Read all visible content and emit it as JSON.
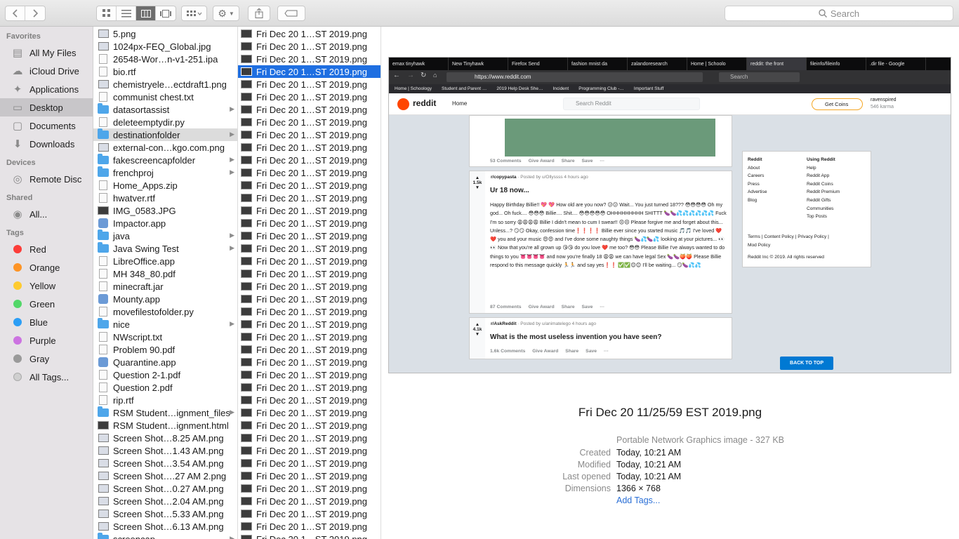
{
  "window": {
    "search_placeholder": "Search"
  },
  "toolbar": {
    "back_icon": "chevron-left-icon",
    "forward_icon": "chevron-right-icon",
    "view_modes": [
      "icon-view-icon",
      "list-view-icon",
      "column-view-icon",
      "gallery-view-icon"
    ],
    "active_view": 2
  },
  "sidebar": {
    "favorites_header": "Favorites",
    "favorites": [
      {
        "label": "All My Files",
        "icon": "all-files-icon"
      },
      {
        "label": "iCloud Drive",
        "icon": "cloud-icon"
      },
      {
        "label": "Applications",
        "icon": "applications-icon"
      },
      {
        "label": "Desktop",
        "icon": "desktop-icon",
        "selected": true
      },
      {
        "label": "Documents",
        "icon": "documents-icon"
      },
      {
        "label": "Downloads",
        "icon": "downloads-icon"
      }
    ],
    "devices_header": "Devices",
    "devices": [
      {
        "label": "Remote Disc",
        "icon": "disc-icon"
      }
    ],
    "shared_header": "Shared",
    "shared": [
      {
        "label": "All...",
        "icon": "network-icon"
      }
    ],
    "tags_header": "Tags",
    "tags": [
      {
        "label": "Red",
        "color": "#fc3d39"
      },
      {
        "label": "Orange",
        "color": "#fd9426"
      },
      {
        "label": "Yellow",
        "color": "#fecb2f"
      },
      {
        "label": "Green",
        "color": "#53d769"
      },
      {
        "label": "Blue",
        "color": "#2c9ef5"
      },
      {
        "label": "Purple",
        "color": "#cc73e1"
      },
      {
        "label": "Gray",
        "color": "#9a9a9a"
      },
      {
        "label": "All Tags...",
        "color": "#cfcfcf"
      }
    ]
  },
  "column1": [
    {
      "name": "5.png",
      "kind": "img"
    },
    {
      "name": "1024px-FEQ_Global.jpg",
      "kind": "img"
    },
    {
      "name": "26548-Wor…n-v1-251.ipa",
      "kind": "doc"
    },
    {
      "name": "bio.rtf",
      "kind": "doc"
    },
    {
      "name": "chemistryele…ectdraft1.png",
      "kind": "img"
    },
    {
      "name": "communist chest.txt",
      "kind": "doc"
    },
    {
      "name": "datasortassist",
      "kind": "folder"
    },
    {
      "name": "deleteemptydir.py",
      "kind": "doc"
    },
    {
      "name": "destinationfolder",
      "kind": "folder",
      "highlight": true
    },
    {
      "name": "external-con…kgo.com.png",
      "kind": "img"
    },
    {
      "name": "fakescreencapfolder",
      "kind": "folder"
    },
    {
      "name": "frenchproj",
      "kind": "folder"
    },
    {
      "name": "Home_Apps.zip",
      "kind": "doc"
    },
    {
      "name": "hwatver.rtf",
      "kind": "doc"
    },
    {
      "name": "IMG_0583.JPG",
      "kind": "png"
    },
    {
      "name": "Impactor.app",
      "kind": "app"
    },
    {
      "name": "java",
      "kind": "folder"
    },
    {
      "name": "Java Swing Test",
      "kind": "folder"
    },
    {
      "name": "LibreOffice.app",
      "kind": "doc"
    },
    {
      "name": "MH 348_80.pdf",
      "kind": "doc"
    },
    {
      "name": "minecraft.jar",
      "kind": "doc"
    },
    {
      "name": "Mounty.app",
      "kind": "app"
    },
    {
      "name": "movefilestofolder.py",
      "kind": "doc"
    },
    {
      "name": "nice",
      "kind": "folder"
    },
    {
      "name": "NWscript.txt",
      "kind": "doc"
    },
    {
      "name": "Problem 90.pdf",
      "kind": "doc"
    },
    {
      "name": "Quarantine.app",
      "kind": "app"
    },
    {
      "name": "Question 2-1.pdf",
      "kind": "doc"
    },
    {
      "name": "Question 2.pdf",
      "kind": "doc"
    },
    {
      "name": "rip.rtf",
      "kind": "doc"
    },
    {
      "name": "RSM Student…ignment_files",
      "kind": "folder"
    },
    {
      "name": "RSM Student…ignment.html",
      "kind": "png"
    },
    {
      "name": "Screen Shot…8.25 AM.png",
      "kind": "img"
    },
    {
      "name": "Screen Shot…1.43 AM.png",
      "kind": "img"
    },
    {
      "name": "Screen Shot…3.54 AM.png",
      "kind": "img"
    },
    {
      "name": "Screen Shot….27 AM 2.png",
      "kind": "img"
    },
    {
      "name": "Screen Shot…0.27 AM.png",
      "kind": "img"
    },
    {
      "name": "Screen Shot…2.04 AM.png",
      "kind": "img"
    },
    {
      "name": "Screen Shot…5.33 AM.png",
      "kind": "img"
    },
    {
      "name": "Screen Shot…6.13 AM.png",
      "kind": "img"
    },
    {
      "name": "screencap",
      "kind": "folder"
    }
  ],
  "column1_folders_with_arrow": [
    6,
    8,
    10,
    11,
    16,
    17,
    23,
    30,
    40
  ],
  "column2": {
    "item_label": "Fri Dec 20 1…ST 2019.png",
    "count": 41,
    "selected_index": 3
  },
  "preview": {
    "browser": {
      "tabs": [
        "emax tinyhawk",
        "New Tinyhawk",
        "Firefox Send",
        "fashion mnist da",
        "zalandoresearch",
        "Home | Schoolo",
        "reddit: the front",
        "fileinfo/fileinfo",
        ".dir file - Google"
      ],
      "active_tab": 6,
      "url": "https://www.reddit.com",
      "find_placeholder": "Search",
      "bookmarks": [
        "Home | Schoology",
        "Student and Parent …",
        "2019 Help Desk She…",
        "Incident",
        "Programming Club -…",
        "Important Stuff"
      ]
    },
    "reddit": {
      "wordmark": "reddit",
      "home": "Home",
      "search_placeholder": "Search Reddit",
      "coins": "Get Coins",
      "username": "ravenspired",
      "karma": "546 karma",
      "post1_footer": [
        "53 Comments",
        "Give Award",
        "Share",
        "Save",
        "···"
      ],
      "post2": {
        "votes": "1.5k",
        "sub": "r/copypasta",
        "meta": " · Posted by u/Ollyssss 4 hours ago",
        "title": "Ur 18 now...",
        "body": "Happy Birthday Billie!! 💖 💖 How old are you now? 😕😕 Wait... You just turned 18??? 😳😳😳😳 Oh my god... Oh fuck.... 😳😳😳 Billie.... Shit.... 😳😳😳😳😳 OHHHHHHHHH SHITTT 🍆🍆💦💦💦💦💦💦 Fuck I'm so sorry 😩😩😩😩 Billie I didn't mean to cum I swear!! 😣😣 Please forgive me and forget about this... Unless...? 😏😏 Okay, confession time❗❗❗❗ Billie ever since you started music 🎵🎵 I've loved ❤️❤️ you and your music 😍😍 and I've done some naughty things 🍆💦🍆💦 looking at your pictures... 👀👀 Now that you're all grown up 😘😘 do you love ❤️ me too? 😳😳 Please Billie I've always wanted to do things to you 👅👅👅👅 and now you're finally 18 😩😩 we can have legal Sex 🍆🍆🍑🍑 Please Billie respond to this message quickly 🏃🏃 and say yes❗❗ ✅✅😊😊 I'll be waiting... 😏🍆💦💦",
        "footer": [
          "87 Comments",
          "Give Award",
          "Share",
          "Save",
          "···"
        ]
      },
      "post3": {
        "votes": "4.1k",
        "sub": "r/AskReddit",
        "meta": " · Posted by u/animatelego 4 hours ago",
        "title": "What is the most useless invention you have seen?",
        "footer": [
          "1.6k Comments",
          "Give Award",
          "Share",
          "Save",
          "···"
        ]
      },
      "side_col1": [
        "Reddit",
        "About",
        "Careers",
        "Press",
        "Advertise",
        "Blog"
      ],
      "side_col2": [
        "Using Reddit",
        "Help",
        "Reddit App",
        "Reddit Coins",
        "Reddit Premium",
        "Reddit Gifts",
        "Communities",
        "Top Posts"
      ],
      "legal": "Terms  |  Content Policy  |  Privacy Policy  |",
      "mod_policy": "Mod Policy",
      "copyright": "Reddit Inc © 2019. All rights reserved",
      "back_to_top": "BACK TO TOP"
    },
    "file_name": "Fri Dec 20 11/25/59 EST 2019.png",
    "file_type": "Portable Network Graphics image - 327 KB",
    "meta_labels": [
      "Created",
      "Modified",
      "Last opened",
      "Dimensions"
    ],
    "meta_values": [
      "Today, 10:21 AM",
      "Today, 10:21 AM",
      "Today, 10:21 AM",
      "1366 × 768"
    ],
    "add_tags": "Add Tags..."
  }
}
